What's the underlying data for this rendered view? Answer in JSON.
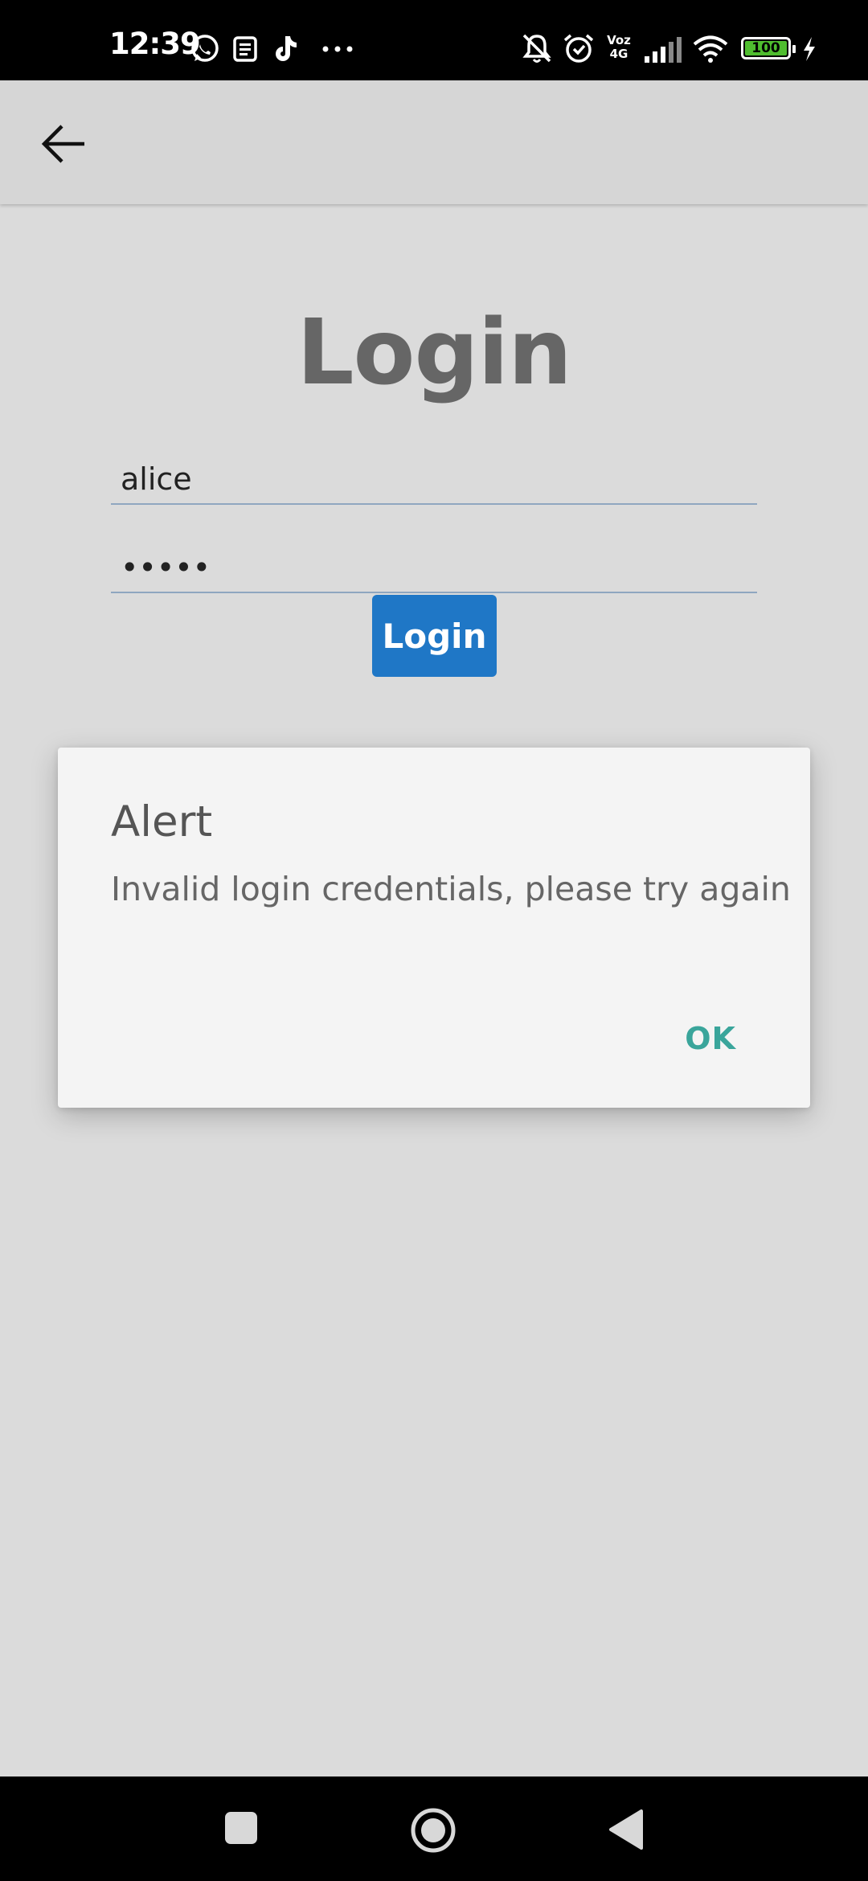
{
  "status_bar": {
    "time": "12:39",
    "notification_icons": [
      "whatsapp-icon",
      "notes-icon",
      "tiktok-icon",
      "more-icon"
    ],
    "right_icons": [
      "silent-bell-icon",
      "alarm-icon",
      "volte-icon",
      "signal-icon",
      "wifi-icon",
      "battery-icon",
      "charging-icon"
    ],
    "network_label_top": "Voz",
    "network_label_bottom": "4G",
    "battery": "100"
  },
  "app_bar": {
    "back_icon": "arrow-back-icon"
  },
  "login": {
    "title": "Login",
    "username_value": "alice",
    "password_value": "•••••",
    "button_label": "Login"
  },
  "dialog": {
    "title": "Alert",
    "message": "Invalid login credentials, please try again",
    "ok_label": "OK"
  },
  "nav_bar": {
    "items": [
      "recents-icon",
      "home-icon",
      "back-icon"
    ]
  },
  "colors": {
    "primary_button": "#1f77c6",
    "dialog_action": "#3aa59b",
    "background": "#dbdbdb"
  }
}
